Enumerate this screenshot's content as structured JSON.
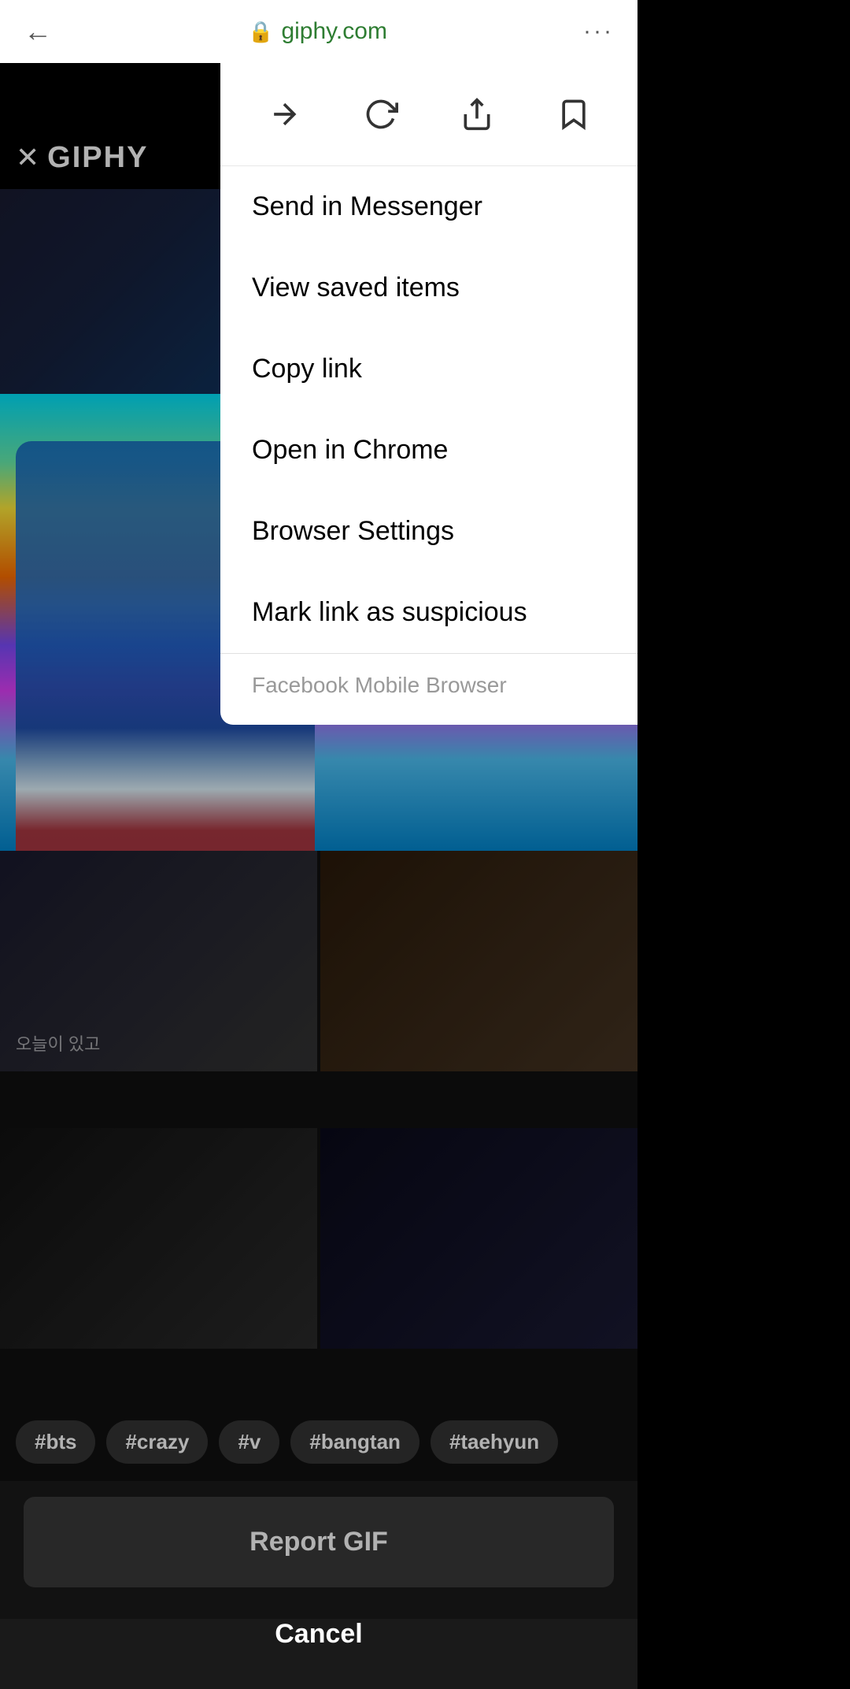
{
  "statusBar": {
    "url": "giphy.com",
    "backLabel": "←",
    "moreLabel": "···"
  },
  "giphyHeader": {
    "closeLabel": "✕",
    "logoLabel": "GIPHY"
  },
  "dropdown": {
    "icons": [
      {
        "name": "forward-icon",
        "label": "→"
      },
      {
        "name": "reload-icon",
        "label": "↺"
      },
      {
        "name": "share-icon",
        "label": "↗"
      },
      {
        "name": "bookmark-icon",
        "label": "🔖"
      }
    ],
    "items": [
      {
        "key": "send-messenger",
        "label": "Send in Messenger"
      },
      {
        "key": "view-saved",
        "label": "View saved items"
      },
      {
        "key": "copy-link",
        "label": "Copy link"
      },
      {
        "key": "open-chrome",
        "label": "Open in Chrome"
      },
      {
        "key": "browser-settings",
        "label": "Browser Settings"
      },
      {
        "key": "mark-suspicious",
        "label": "Mark link as suspicious"
      }
    ],
    "footer": "Facebook Mobile Browser"
  },
  "tags": [
    "#bts",
    "#crazy",
    "#v",
    "#bangtan",
    "#taehyun"
  ],
  "actions": {
    "reportGif": "Report GIF",
    "cancel": "Cancel"
  },
  "gridCells": [
    {
      "label": "오늘이 있고"
    },
    {
      "label": ""
    },
    {
      "label": ""
    },
    {
      "label": ""
    }
  ]
}
